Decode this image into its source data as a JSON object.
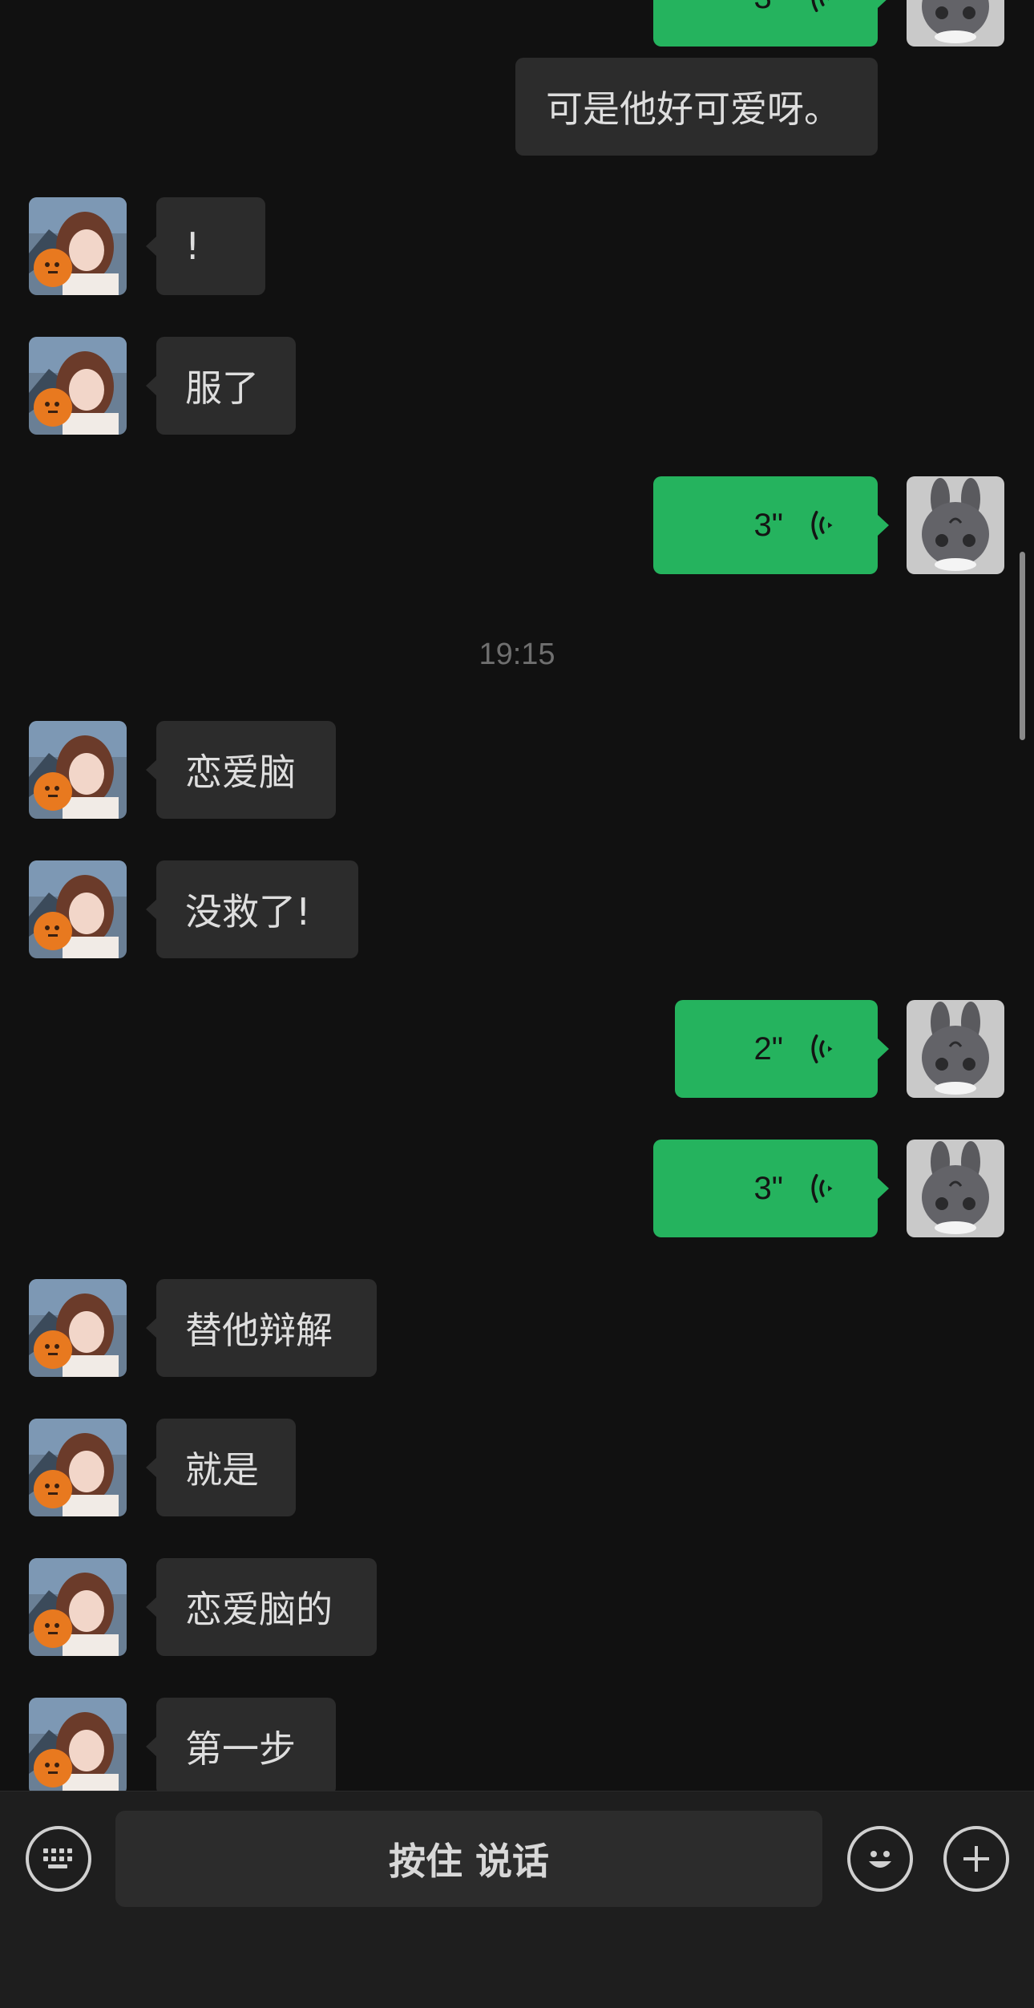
{
  "timestamp": "19:15",
  "bottom_bar": {
    "hold_to_talk_label": "按住 说话"
  },
  "messages": [
    {
      "side": "out",
      "type": "voice",
      "duration": "3\""
    },
    {
      "side": "out",
      "type": "text",
      "text": "可是他好可爱呀。"
    },
    {
      "side": "in",
      "type": "text",
      "text": "!"
    },
    {
      "side": "in",
      "type": "text",
      "text": "服了"
    },
    {
      "side": "out",
      "type": "voice",
      "duration": "3\""
    },
    {
      "side": "in",
      "type": "text",
      "text": "恋爱脑"
    },
    {
      "side": "in",
      "type": "text",
      "text": "没救了!"
    },
    {
      "side": "out",
      "type": "voice",
      "duration": "2\""
    },
    {
      "side": "out",
      "type": "voice",
      "duration": "3\""
    },
    {
      "side": "in",
      "type": "text",
      "text": "替他辩解"
    },
    {
      "side": "in",
      "type": "text",
      "text": "就是"
    },
    {
      "side": "in",
      "type": "text",
      "text": "恋爱脑的"
    },
    {
      "side": "in",
      "type": "text",
      "text": "第一步"
    }
  ],
  "colors": {
    "background": "#111111",
    "incoming_bubble": "#2c2c2c",
    "voice_bubble": "#25b35e",
    "bottom_bar": "#1e1e1e"
  },
  "icons": {
    "keyboard": "keyboard-icon",
    "emoji": "emoji-icon",
    "plus": "plus-icon",
    "voice": "voice-wave-icon"
  }
}
